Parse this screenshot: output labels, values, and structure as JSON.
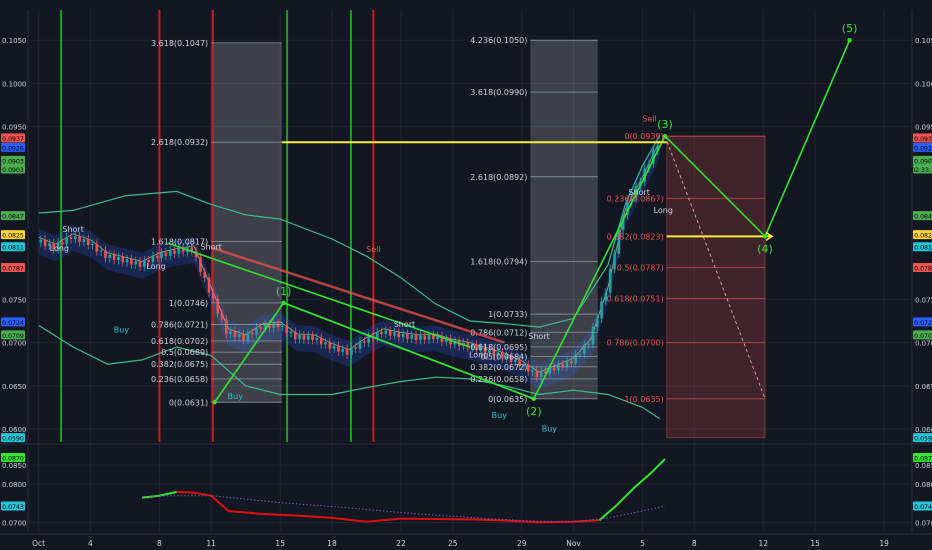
{
  "colors": {
    "background": "#131722",
    "grid": "#1f2433",
    "axis_text": "#d1d4dc",
    "buy": "#26c6da",
    "sell": "#ef5350",
    "wave": "#33e62e",
    "target": "#ffeb3b",
    "band": "#3fbf8f",
    "green_vline": "#17a317",
    "red_vline": "#d41919",
    "candle_up": "#26a69a",
    "candle_down": "#ef5350",
    "oscillator": "#e01010",
    "oscillator_up": "#33e62e"
  },
  "chart_data": [
    {
      "type": "line",
      "role": "price",
      "ylim": [
        0.0585,
        0.1085
      ],
      "yticks": [
        "0.1050",
        "0.1000",
        "0.0950",
        "0.0750",
        "0.0700",
        "0.0650",
        "0.0600"
      ],
      "xticks": [
        "Oct",
        "4",
        "8",
        "11",
        "15",
        "18",
        "22",
        "25",
        "29",
        "Nov",
        "5",
        "8",
        "12",
        "15",
        "19"
      ],
      "xtick_days": [
        1,
        4,
        8,
        11,
        15,
        18,
        22,
        25,
        29,
        32,
        36,
        39,
        43,
        46,
        50
      ],
      "xlim": [
        0.5,
        51.5
      ],
      "price_labels_left": [
        {
          "value": 0.0937,
          "text": "0.0937",
          "color": "#ef5350"
        },
        {
          "value": 0.0926,
          "text": "0.0926",
          "color": "#2962ff"
        },
        {
          "value": 0.0911,
          "text": "0.0903",
          "color": "#4caf50"
        },
        {
          "value": 0.0901,
          "text": "0.0903",
          "color": "#4caf50"
        },
        {
          "value": 0.0847,
          "text": "0.0847",
          "color": "#4caf50"
        },
        {
          "value": 0.0825,
          "text": "0.0825",
          "color": "#fdd835"
        },
        {
          "value": 0.0811,
          "text": "0.0811",
          "color": "#26c6da"
        },
        {
          "value": 0.0787,
          "text": "0.0787",
          "color": "#ef5350"
        },
        {
          "value": 0.0724,
          "text": "0.0724",
          "color": "#2962ff"
        },
        {
          "value": 0.0709,
          "text": "0.0709",
          "color": "#4caf50"
        },
        {
          "value": 0.059,
          "text": "0.0590",
          "color": "#26c6da"
        }
      ],
      "price_labels_right": [
        {
          "value": 0.0937,
          "text": "0.0937",
          "color": "#ef5350"
        },
        {
          "value": 0.0926,
          "text": "0.0926",
          "color": "#2962ff"
        },
        {
          "value": 0.0911,
          "text": "0.0903",
          "color": "#4caf50"
        },
        {
          "value": 0.0901,
          "text": "02:33:57",
          "color": "#4caf50"
        },
        {
          "value": 0.0847,
          "text": "0.0847",
          "color": "#4caf50"
        },
        {
          "value": 0.0825,
          "text": "0.0825",
          "color": "#fdd835"
        },
        {
          "value": 0.0811,
          "text": "0.0811",
          "color": "#26c6da"
        },
        {
          "value": 0.0787,
          "text": "0.0787",
          "color": "#ef5350"
        },
        {
          "value": 0.0724,
          "text": "0.0724",
          "color": "#2962ff"
        },
        {
          "value": 0.0709,
          "text": "0.0709",
          "color": "#4caf50"
        },
        {
          "value": 0.059,
          "text": "0.0590",
          "color": "#26c6da"
        }
      ],
      "close": [
        [
          1,
          0.0818
        ],
        [
          2,
          0.081
        ],
        [
          3,
          0.0822
        ],
        [
          4,
          0.0815
        ],
        [
          5,
          0.08
        ],
        [
          6,
          0.0795
        ],
        [
          7,
          0.079
        ],
        [
          8,
          0.08
        ],
        [
          9,
          0.0805
        ],
        [
          10,
          0.0808
        ],
        [
          11,
          0.076
        ],
        [
          12,
          0.0712
        ],
        [
          13,
          0.0705
        ],
        [
          14,
          0.0718
        ],
        [
          15,
          0.072
        ],
        [
          16,
          0.0706
        ],
        [
          17,
          0.0705
        ],
        [
          18,
          0.0695
        ],
        [
          19,
          0.0688
        ],
        [
          20,
          0.0702
        ],
        [
          21,
          0.0712
        ],
        [
          22,
          0.0708
        ],
        [
          23,
          0.0705
        ],
        [
          24,
          0.0706
        ],
        [
          25,
          0.07
        ],
        [
          26,
          0.0696
        ],
        [
          27,
          0.069
        ],
        [
          28,
          0.0684
        ],
        [
          29,
          0.0675
        ],
        [
          30,
          0.0662
        ],
        [
          31,
          0.067
        ],
        [
          32,
          0.0678
        ],
        [
          33,
          0.07
        ],
        [
          34,
          0.076
        ],
        [
          35,
          0.085
        ],
        [
          36,
          0.0888
        ],
        [
          37,
          0.093
        ]
      ],
      "bands_upper": [
        [
          1,
          0.085
        ],
        [
          3,
          0.0853
        ],
        [
          6,
          0.087
        ],
        [
          9,
          0.0875
        ],
        [
          11,
          0.086
        ],
        [
          13,
          0.0848
        ],
        [
          15,
          0.0843
        ],
        [
          18,
          0.082
        ],
        [
          20,
          0.08
        ],
        [
          22,
          0.0775
        ],
        [
          24,
          0.0745
        ],
        [
          26,
          0.0725
        ],
        [
          28,
          0.0722
        ],
        [
          30,
          0.0718
        ],
        [
          32,
          0.0728
        ],
        [
          34,
          0.079
        ],
        [
          35,
          0.086
        ],
        [
          36,
          0.0905
        ],
        [
          37,
          0.094
        ]
      ],
      "bands_lower": [
        [
          1,
          0.072
        ],
        [
          3,
          0.0695
        ],
        [
          5,
          0.0675
        ],
        [
          7,
          0.068
        ],
        [
          9,
          0.0695
        ],
        [
          11,
          0.0685
        ],
        [
          13,
          0.065
        ],
        [
          15,
          0.064
        ],
        [
          18,
          0.064
        ],
        [
          20,
          0.0648
        ],
        [
          22,
          0.0655
        ],
        [
          24,
          0.066
        ],
        [
          26,
          0.0658
        ],
        [
          28,
          0.065
        ],
        [
          30,
          0.064
        ],
        [
          32,
          0.0645
        ],
        [
          34,
          0.064
        ],
        [
          36,
          0.0625
        ],
        [
          37,
          0.0612
        ]
      ],
      "vertical_lines": [
        {
          "x": 2.3,
          "color": "green"
        },
        {
          "x": 8.0,
          "color": "red"
        },
        {
          "x": 11.1,
          "color": "red"
        },
        {
          "x": 15.4,
          "color": "green"
        },
        {
          "x": 19.1,
          "color": "green"
        },
        {
          "x": 20.4,
          "color": "red"
        }
      ],
      "shaded_zones": [
        {
          "x0": 11.0,
          "x1": 15.1,
          "y0": 0.0631,
          "y1": 0.1047,
          "color": "#ffffff"
        },
        {
          "x0": 29.5,
          "x1": 33.4,
          "y0": 0.0635,
          "y1": 0.105,
          "color": "#ffffff"
        },
        {
          "x0": 37.4,
          "x1": 43.1,
          "y0": 0.059,
          "y1": 0.0939,
          "color": "#ef5350"
        }
      ],
      "fib_levels": [
        {
          "text": "3.618(0.1047)",
          "value": 0.1047,
          "x0": 11.0,
          "x1": 15.1
        },
        {
          "text": "2.618(0.0932)",
          "value": 0.0932,
          "x0": 11.0,
          "x1": 15.1
        },
        {
          "text": "1.618(0.0817)",
          "value": 0.0817,
          "x0": 11.0,
          "x1": 15.1
        },
        {
          "text": "1(0.0746)",
          "value": 0.0746,
          "x0": 11.0,
          "x1": 15.1
        },
        {
          "text": "0.786(0.0721)",
          "value": 0.0721,
          "x0": 11.0,
          "x1": 15.1
        },
        {
          "text": "0.618(0.0702)",
          "value": 0.0702,
          "x0": 11.0,
          "x1": 15.1
        },
        {
          "text": "0.5(0.0689)",
          "value": 0.0689,
          "x0": 11.0,
          "x1": 15.1
        },
        {
          "text": "0.382(0.0675)",
          "value": 0.0675,
          "x0": 11.0,
          "x1": 15.1
        },
        {
          "text": "0.236(0.0658)",
          "value": 0.0658,
          "x0": 11.0,
          "x1": 15.1
        },
        {
          "text": "0(0.0631)",
          "value": 0.0631,
          "x0": 11.0,
          "x1": 15.1
        },
        {
          "text": "4.236(0.1050)",
          "value": 0.105,
          "x0": 29.5,
          "x1": 33.4
        },
        {
          "text": "3.618(0.0990)",
          "value": 0.099,
          "x0": 29.5,
          "x1": 33.4
        },
        {
          "text": "2.618(0.0892)",
          "value": 0.0892,
          "x0": 29.5,
          "x1": 33.4
        },
        {
          "text": "1.618(0.0794)",
          "value": 0.0794,
          "x0": 29.5,
          "x1": 33.4
        },
        {
          "text": "1(0.0733)",
          "value": 0.0733,
          "x0": 29.5,
          "x1": 33.4
        },
        {
          "text": "0.786(0.0712)",
          "value": 0.0712,
          "x0": 29.5,
          "x1": 33.4
        },
        {
          "text": "0.618(0.0695)",
          "value": 0.0695,
          "x0": 29.5,
          "x1": 33.4
        },
        {
          "text": "0.5(0.0684)",
          "value": 0.0684,
          "x0": 29.5,
          "x1": 33.4
        },
        {
          "text": "0.382(0.0672)",
          "value": 0.0672,
          "x0": 29.5,
          "x1": 33.4
        },
        {
          "text": "0.236(0.0658)",
          "value": 0.0658,
          "x0": 29.5,
          "x1": 33.4
        },
        {
          "text": "0(0.0635)",
          "value": 0.0635,
          "x0": 29.5,
          "x1": 33.4
        },
        {
          "text": "0(0.0939)",
          "value": 0.0939,
          "x0": 37.4,
          "x1": 43.1
        },
        {
          "text": "0.236(0.0867)",
          "value": 0.0867,
          "x0": 37.4,
          "x1": 43.1
        },
        {
          "text": "0.382(0.0823)",
          "value": 0.0823,
          "x0": 37.4,
          "x1": 43.1
        },
        {
          "text": "0.5(0.0787)",
          "value": 0.0787,
          "x0": 37.4,
          "x1": 43.1
        },
        {
          "text": "0.618(0.0751)",
          "value": 0.0751,
          "x0": 37.4,
          "x1": 43.1
        },
        {
          "text": "0.786(0.0700)",
          "value": 0.07,
          "x0": 37.4,
          "x1": 43.1
        },
        {
          "text": "1(0.0635)",
          "value": 0.0635,
          "x0": 37.4,
          "x1": 43.1
        }
      ],
      "wave_points": [
        {
          "label": "",
          "x": 11.2,
          "y": 0.0631
        },
        {
          "label": "(1)",
          "x": 15.2,
          "y": 0.0746
        },
        {
          "label": "(2)",
          "x": 29.7,
          "y": 0.0635
        },
        {
          "label": "(3)",
          "x": 37.3,
          "y": 0.0939
        },
        {
          "label": "(4)",
          "x": 43.1,
          "y": 0.0823
        },
        {
          "label": "(5)",
          "x": 48.0,
          "y": 0.105
        }
      ],
      "trend_lines": [
        {
          "color": "wave",
          "points": [
            [
              11.2,
              0.0631
            ],
            [
              15.2,
              0.0746
            ],
            [
              29.7,
              0.0635
            ],
            [
              37.3,
              0.0939
            ],
            [
              43.1,
              0.0823
            ],
            [
              48.0,
              0.105
            ]
          ]
        },
        {
          "color": "wave",
          "points": [
            [
              15.2,
              0.0746
            ],
            [
              29.7,
              0.0635
            ]
          ]
        },
        {
          "color": "wave",
          "points": [
            [
              8.5,
              0.0815
            ],
            [
              26.0,
              0.0695
            ]
          ]
        },
        {
          "color": "sell",
          "points": [
            [
              11.0,
              0.081
            ],
            [
              28.0,
              0.07
            ]
          ]
        }
      ],
      "target_lines": [
        {
          "value": 0.0932,
          "x0": 15.1,
          "x1": 37.4
        },
        {
          "value": 0.0823,
          "x0": 37.4,
          "x1": 43.5
        }
      ],
      "signals": [
        {
          "text": "Long",
          "x": 2.2,
          "y": 0.0806,
          "color": "#d1d4dc"
        },
        {
          "text": "Short",
          "x": 3.0,
          "y": 0.0828,
          "color": "#d1d4dc"
        },
        {
          "text": "Long",
          "x": 7.8,
          "y": 0.0785,
          "color": "#d1d4dc"
        },
        {
          "text": "Short",
          "x": 11.0,
          "y": 0.0808,
          "color": "#d1d4dc"
        },
        {
          "text": "Buy",
          "x": 5.8,
          "y": 0.0712,
          "color": "#26c6da"
        },
        {
          "text": "Buy",
          "x": 12.4,
          "y": 0.0635,
          "color": "#26c6da"
        },
        {
          "text": "Sell",
          "x": 20.4,
          "y": 0.0805,
          "color": "#ef5350"
        },
        {
          "text": "Short",
          "x": 22.2,
          "y": 0.0718,
          "color": "#d1d4dc"
        },
        {
          "text": "Long",
          "x": 26.5,
          "y": 0.0683,
          "color": "#d1d4dc"
        },
        {
          "text": "Short",
          "x": 30.0,
          "y": 0.0704,
          "color": "#d1d4dc"
        },
        {
          "text": "Buy",
          "x": 27.7,
          "y": 0.0613,
          "color": "#26c6da"
        },
        {
          "text": "Buy",
          "x": 30.6,
          "y": 0.0597,
          "color": "#26c6da"
        },
        {
          "text": "Sell",
          "x": 36.4,
          "y": 0.0956,
          "color": "#ef5350"
        },
        {
          "text": "Short",
          "x": 35.8,
          "y": 0.0871,
          "color": "#d1d4dc"
        },
        {
          "text": "Long",
          "x": 37.2,
          "y": 0.085,
          "color": "#d1d4dc"
        }
      ]
    },
    {
      "type": "line",
      "role": "oscillator",
      "ylim": [
        0.0675,
        0.09
      ],
      "yticks": [
        "0.0850",
        "0.0800",
        "0.0700"
      ],
      "yticks_values": [
        0.085,
        0.08,
        0.07
      ],
      "price_labels_left": [
        {
          "value": 0.087,
          "text": "0.0870",
          "color": "#33e62e"
        },
        {
          "value": 0.0743,
          "text": "0.0743",
          "color": "#26c6da"
        }
      ],
      "price_labels_right": [
        {
          "value": 0.087,
          "text": "0.0870",
          "color": "#33e62e"
        },
        {
          "value": 0.0743,
          "text": "0.0743",
          "color": "#26c6da"
        }
      ],
      "fast_line": [
        [
          7.0,
          0.0765
        ],
        [
          8.0,
          0.077
        ],
        [
          9.0,
          0.078
        ],
        [
          10.0,
          0.0778
        ],
        [
          11.0,
          0.077
        ],
        [
          12.0,
          0.073
        ],
        [
          14.0,
          0.0722
        ],
        [
          16.0,
          0.0718
        ],
        [
          18.0,
          0.0712
        ],
        [
          20.0,
          0.0702
        ],
        [
          22.0,
          0.071
        ],
        [
          24.0,
          0.0709
        ],
        [
          26.0,
          0.0708
        ],
        [
          28.0,
          0.0705
        ],
        [
          30.0,
          0.07
        ],
        [
          32.0,
          0.0702
        ],
        [
          33.5,
          0.0706
        ],
        [
          34.5,
          0.0745
        ],
        [
          35.5,
          0.079
        ],
        [
          36.5,
          0.083
        ],
        [
          37.3,
          0.0866
        ]
      ],
      "slow_line": [
        [
          7.0,
          0.0768
        ],
        [
          9.0,
          0.077
        ],
        [
          11.0,
          0.077
        ],
        [
          15.0,
          0.0752
        ],
        [
          19.0,
          0.0738
        ],
        [
          23.0,
          0.0722
        ],
        [
          27.0,
          0.071
        ],
        [
          30.0,
          0.0703
        ],
        [
          32.0,
          0.0702
        ],
        [
          34.0,
          0.0712
        ],
        [
          36.0,
          0.073
        ],
        [
          37.3,
          0.0743
        ]
      ]
    }
  ]
}
